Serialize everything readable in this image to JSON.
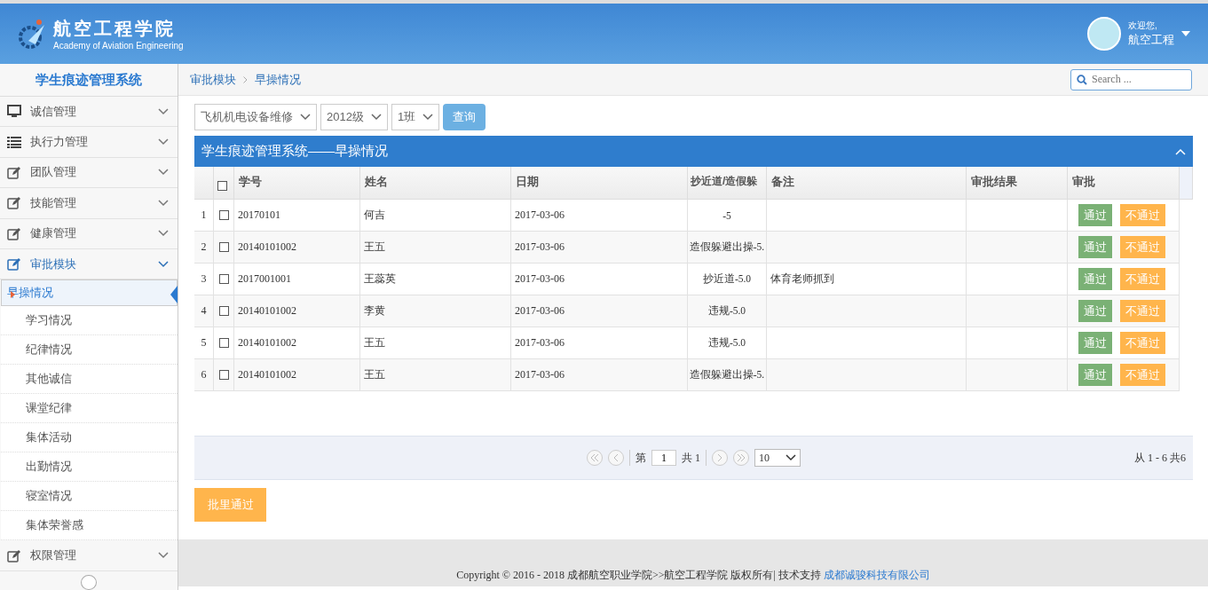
{
  "header": {
    "logo_title": "航空工程学院",
    "logo_subtitle": "Academy of Aviation Engineering",
    "greeting": "欢迎您,",
    "username": "航空工程"
  },
  "sidebar": {
    "title": "学生痕迹管理系统",
    "items": [
      {
        "label": "诚信管理",
        "expanded": false
      },
      {
        "label": "执行力管理",
        "expanded": false
      },
      {
        "label": "团队管理",
        "expanded": false
      },
      {
        "label": "技能管理",
        "expanded": false
      },
      {
        "label": "健康管理",
        "expanded": false
      },
      {
        "label": "审批模块",
        "expanded": true,
        "children": [
          {
            "label": "早操情况",
            "selected": true
          },
          {
            "label": "学习情况",
            "selected": false
          },
          {
            "label": "纪律情况",
            "selected": false
          },
          {
            "label": "其他诚信",
            "selected": false
          },
          {
            "label": "课堂纪律",
            "selected": false
          },
          {
            "label": "集体活动",
            "selected": false
          },
          {
            "label": "出勤情况",
            "selected": false
          },
          {
            "label": "寝室情况",
            "selected": false
          },
          {
            "label": "集体荣誉感",
            "selected": false
          }
        ]
      },
      {
        "label": "权限管理",
        "expanded": false
      }
    ]
  },
  "breadcrumb": [
    "审批模块",
    "早操情况"
  ],
  "search": {
    "placeholder": "Search ..."
  },
  "filters": {
    "selects": [
      "飞机机电设备维修",
      "2012级",
      "1班"
    ],
    "button": "查询"
  },
  "panel": {
    "title": "学生痕迹管理系统——早操情况",
    "expanded": true
  },
  "table": {
    "select_all_checked": false,
    "columns": [
      "学号",
      "姓名",
      "日期",
      "抄近道/造假躲",
      "备注",
      "审批结果",
      "审批"
    ],
    "rows": [
      {
        "num": "1",
        "checked": false,
        "cells": [
          "20170101",
          "何吉",
          "2017-03-06",
          "-5",
          "",
          ""
        ],
        "actions": [
          "通过",
          "不通过"
        ]
      },
      {
        "num": "2",
        "checked": false,
        "cells": [
          "20140101002",
          "王五",
          "2017-03-06",
          "造假躲避出操-5.",
          "",
          ""
        ],
        "actions": [
          "通过",
          "不通过"
        ]
      },
      {
        "num": "3",
        "checked": false,
        "cells": [
          "2017001001",
          "王蕊英",
          "2017-03-06",
          "抄近道-5.0",
          "体育老师抓到",
          ""
        ],
        "actions": [
          "通过",
          "不通过"
        ]
      },
      {
        "num": "4",
        "checked": false,
        "cells": [
          "20140101002",
          "李黄",
          "2017-03-06",
          "违规-5.0",
          "",
          ""
        ],
        "actions": [
          "通过",
          "不通过"
        ]
      },
      {
        "num": "5",
        "checked": false,
        "cells": [
          "20140101002",
          "王五",
          "2017-03-06",
          "违规-5.0",
          "",
          ""
        ],
        "actions": [
          "通过",
          "不通过"
        ]
      },
      {
        "num": "6",
        "checked": false,
        "cells": [
          "20140101002",
          "王五",
          "2017-03-06",
          "造假躲避出操-5.",
          "",
          ""
        ],
        "actions": [
          "通过",
          "不通过"
        ]
      }
    ]
  },
  "pager": {
    "page_prefix": "第",
    "page": "1",
    "total": "共 1",
    "page_size": "10",
    "summary": "从 1 - 6 共6"
  },
  "batch_button": "批里通过",
  "footer": {
    "text": "Copyright © 2016 - 2018 成都航空职业学院>>航空工程学院 版权所有| 技术支持 ",
    "link": "成都诚骏科技有限公司"
  }
}
